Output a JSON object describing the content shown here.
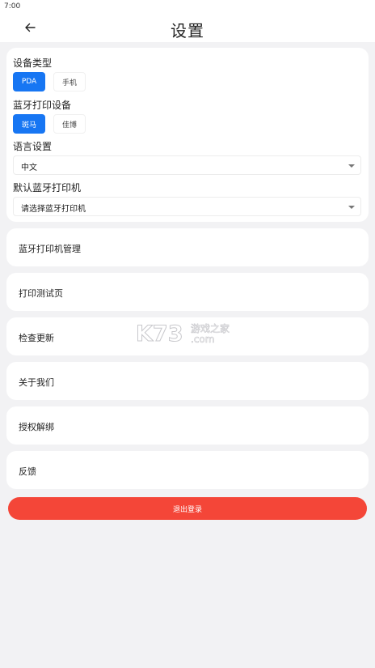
{
  "status_bar": {
    "time": "7:00"
  },
  "header": {
    "title": "设置",
    "back_icon": "arrow-left-icon"
  },
  "settings": {
    "device_type": {
      "label": "设备类型",
      "options": [
        "PDA",
        "手机"
      ],
      "selected": "PDA"
    },
    "bluetooth_device": {
      "label": "蓝牙打印设备",
      "options": [
        "斑马",
        "佳博"
      ],
      "selected": "斑马"
    },
    "language": {
      "label": "语言设置",
      "value": "中文"
    },
    "default_printer": {
      "label": "默认蓝牙打印机",
      "value": "请选择蓝牙打印机"
    }
  },
  "menu": [
    {
      "label": "蓝牙打印机管理"
    },
    {
      "label": "打印测试页"
    },
    {
      "label": "检查更新"
    },
    {
      "label": "关于我们"
    },
    {
      "label": "授权解绑"
    },
    {
      "label": "反馈"
    }
  ],
  "logout": {
    "label": "退出登录"
  },
  "watermark": {
    "brand": "K73",
    "text1": "游戏之家",
    "text2": ".com"
  },
  "colors": {
    "accent": "#1776f3",
    "danger": "#f44638",
    "background": "#f2f2f4"
  }
}
